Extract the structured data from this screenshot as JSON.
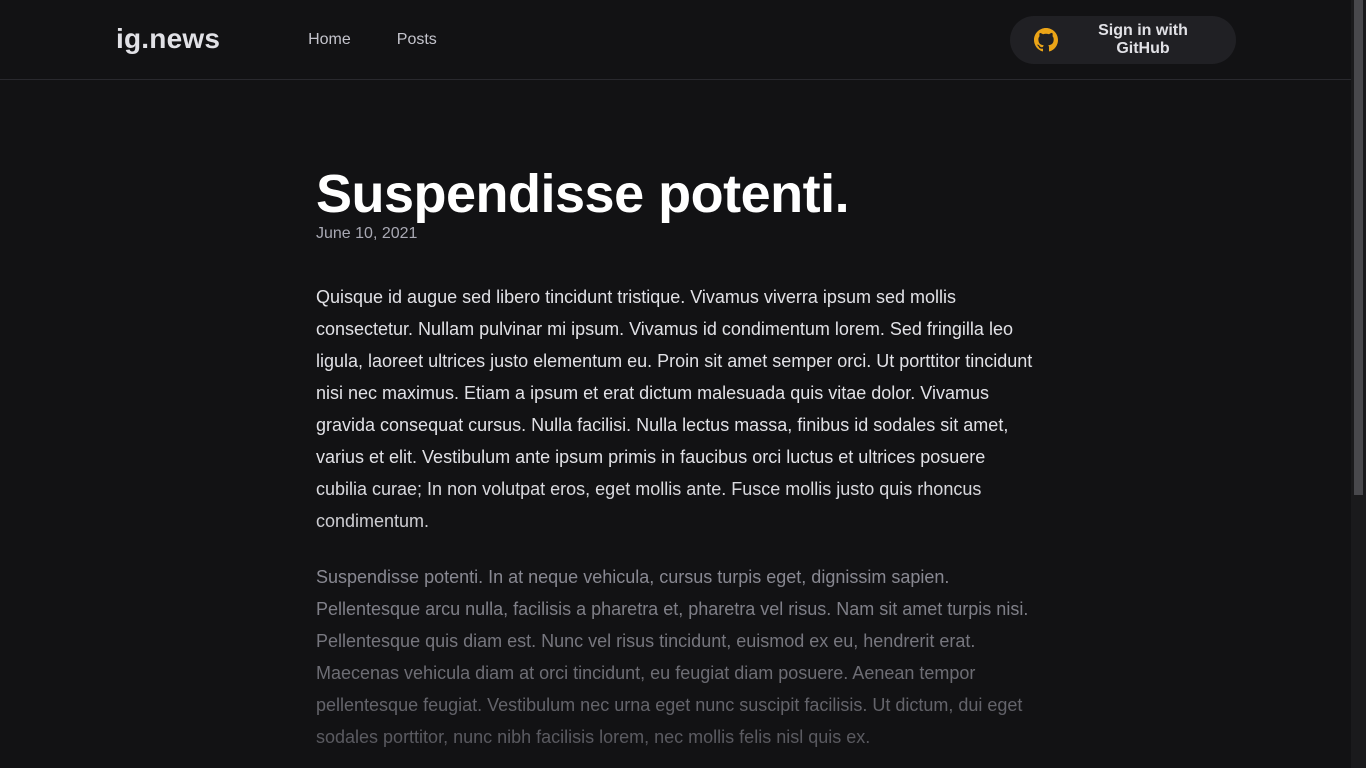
{
  "header": {
    "logo": "ig.news",
    "nav": [
      {
        "label": "Home"
      },
      {
        "label": "Posts"
      }
    ],
    "signin_label": "Sign in with GitHub",
    "signin_icon": "github-icon",
    "signin_icon_color": "#eba417"
  },
  "post": {
    "title": "Suspendisse potenti.",
    "date": "June 10, 2021",
    "paragraphs": [
      "Quisque id augue sed libero tincidunt tristique. Vivamus viverra ipsum sed mollis consectetur. Nullam pulvinar mi ipsum. Vivamus id condimentum lorem. Sed fringilla leo ligula, laoreet ultrices justo elementum eu. Proin sit amet semper orci. Ut porttitor tincidunt nisi nec maximus. Etiam a ipsum et erat dictum malesuada quis vitae dolor. Vivamus gravida consequat cursus. Nulla facilisi. Nulla lectus massa, finibus id sodales sit amet, varius et elit. Vestibulum ante ipsum primis in faucibus orci luctus et ultrices posuere cubilia curae; In non volutpat eros, eget mollis ante. Fusce mollis justo quis rhoncus condimentum.",
      "Suspendisse potenti. In at neque vehicula, cursus turpis eget, dignissim sapien. Pellentesque arcu nulla, facilisis a pharetra et, pharetra vel risus. Nam sit amet turpis nisi. Pellentesque quis diam est. Nunc vel risus tincidunt, euismod ex eu, hendrerit erat. Maecenas vehicula diam at orci tincidunt, eu feugiat diam posuere. Aenean tempor pellentesque feugiat. Vestibulum nec urna eget nunc suscipit facilisis. Ut dictum, dui eget sodales porttitor, nunc nibh facilisis lorem, nec mollis felis nisl quis ex."
    ]
  },
  "colors": {
    "background": "#121214",
    "header_border": "#29292e",
    "button_bg": "#202024",
    "text": "#e1e1e6",
    "muted": "#a8a8b3"
  }
}
